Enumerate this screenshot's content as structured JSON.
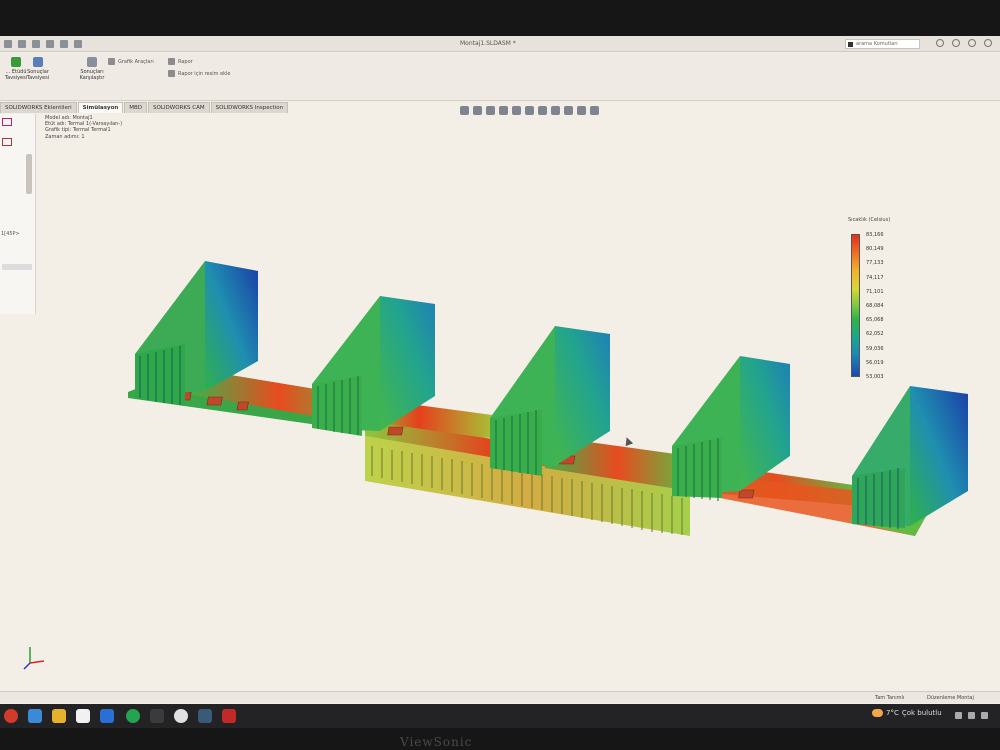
{
  "window": {
    "title": "Montaj1.SLDASM *",
    "search_placeholder": "arama Komutları"
  },
  "ribbon": {
    "buttons": [
      {
        "label": "... Etüdü\nTavsiyesi",
        "color": "#3a9a3a"
      },
      {
        "label": "Sonuçlar\nTavsiyesi",
        "color": "#5b7db8"
      },
      {
        "label": "Sonuçları\nKarşılaştır",
        "color": "#8a8fa0"
      }
    ],
    "small_items": [
      "Grafik Araçları",
      "Rapor",
      "Rapor için resim ekle"
    ]
  },
  "tabs": [
    "SOLIDWORKS Eklentileri",
    "Simülasyon",
    "MBD",
    "SOLIDWORKS CAM",
    "SOLIDWORKS Inspection"
  ],
  "active_tab_index": 1,
  "sidebar": {
    "fragment_text": "1[45P>"
  },
  "info": {
    "model_name": "Model adı: Montaj1",
    "study_name": "Etüt adı: Termal 1(-Varsayılan-)",
    "plot_type": "Grafik tipi: Termal Termal1",
    "time_step": "Zaman adımı: 1"
  },
  "legend": {
    "title": "Sıcaklık (Celsius)",
    "values": [
      "83,166",
      "80,149",
      "77,133",
      "74,117",
      "71,101",
      "68,084",
      "65,068",
      "62,052",
      "59,036",
      "56,019",
      "53,003"
    ],
    "max_color": "#e42d19",
    "min_color": "#1c48b0"
  },
  "status_bar": {
    "left": "Tam Tanımlı",
    "right": "Düzenleme Montaj"
  },
  "taskbar": {
    "weather_temp": "7°C",
    "weather_text": "Çok bulutlu"
  },
  "monitor_brand": "ViewSonic"
}
